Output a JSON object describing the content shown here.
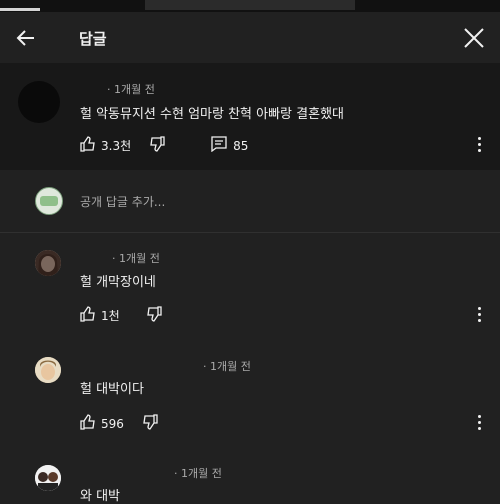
{
  "header": {
    "title": "답글"
  },
  "parent_comment": {
    "time": "· 1개월 전",
    "text": "헐 악동뮤지션 수현 엄마랑 찬혁 아빠랑 결혼했대",
    "likes": "3.3천",
    "reply_count": "85"
  },
  "add_reply": {
    "placeholder": "공개 답글 추가..."
  },
  "replies": [
    {
      "time": "· 1개월 전",
      "text": "헐 개막장이네",
      "likes": "1천"
    },
    {
      "time": "· 1개월 전",
      "text": "헐 대박이다",
      "likes": "596"
    },
    {
      "time": "· 1개월 전",
      "text": "와 대박"
    }
  ],
  "colors": {
    "background": "#212121",
    "parent_background": "#181818",
    "text": "#f1f1f1",
    "secondary_text": "#aaaaaa"
  },
  "icons": [
    "back-arrow-icon",
    "close-icon",
    "thumb-up-icon",
    "thumb-down-icon",
    "comment-icon",
    "more-vert-icon"
  ]
}
